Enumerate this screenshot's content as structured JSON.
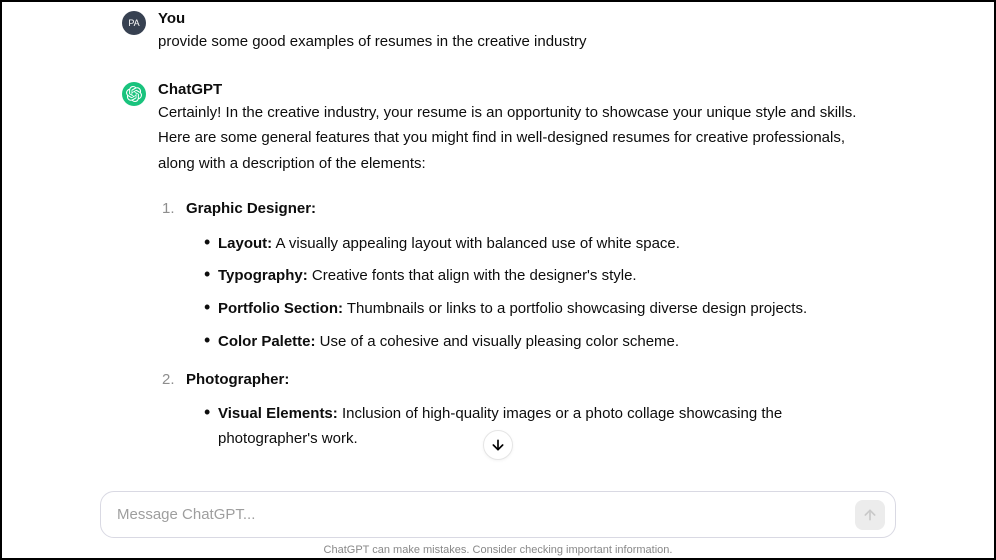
{
  "user": {
    "avatar_text": "PA",
    "name": "You",
    "message": "provide some good examples of resumes in the creative industry"
  },
  "assistant": {
    "name": "ChatGPT",
    "intro": "Certainly! In the creative industry, your resume is an opportunity to showcase your unique style and skills. Here are some general features that you might find in well-designed resumes for creative professionals, along with a description of the elements:",
    "items": [
      {
        "title": "Graphic Designer:",
        "bullets": [
          {
            "label": "Layout:",
            "text": " A visually appealing layout with balanced use of white space."
          },
          {
            "label": "Typography:",
            "text": " Creative fonts that align with the designer's style."
          },
          {
            "label": "Portfolio Section:",
            "text": " Thumbnails or links to a portfolio showcasing diverse design projects."
          },
          {
            "label": "Color Palette:",
            "text": " Use of a cohesive and visually pleasing color scheme."
          }
        ]
      },
      {
        "title": "Photographer:",
        "bullets": [
          {
            "label": "Visual Elements:",
            "text": " Inclusion of high-quality images or a photo collage showcasing the photographer's work."
          }
        ]
      }
    ]
  },
  "input": {
    "placeholder": "Message ChatGPT..."
  },
  "disclaimer": "ChatGPT can make mistakes. Consider checking important information."
}
